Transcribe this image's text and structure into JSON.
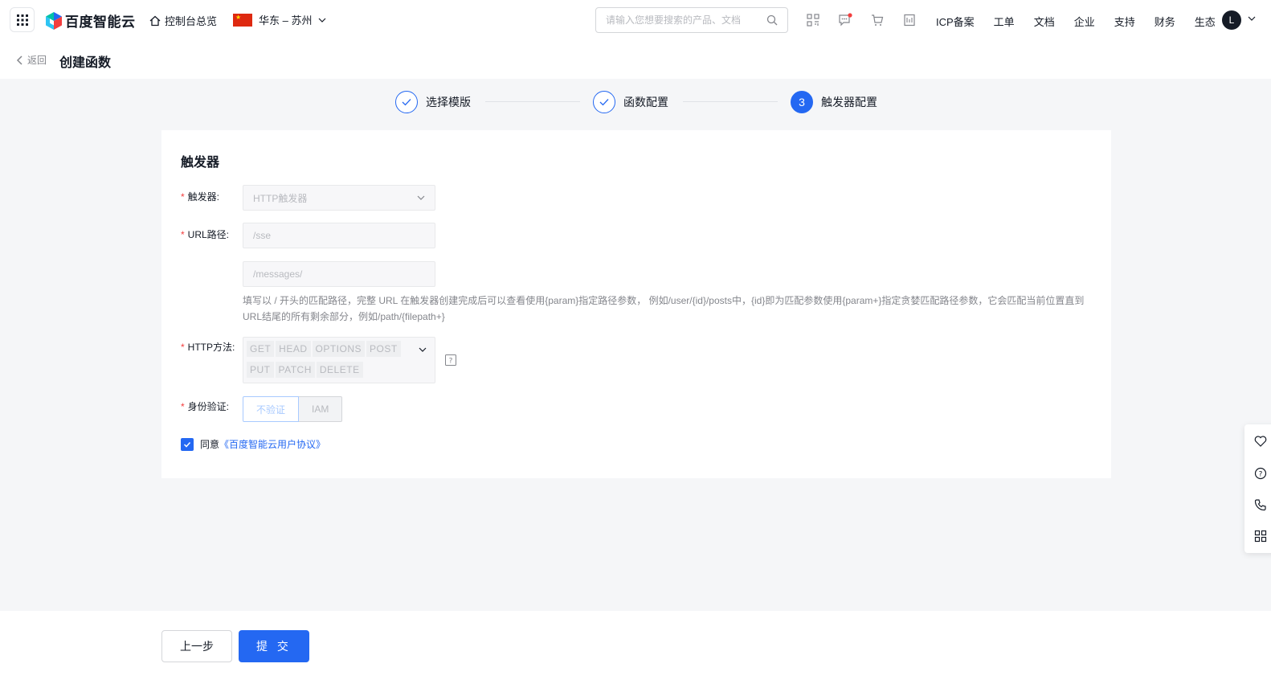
{
  "topbar": {
    "logo_text": "百度智能云",
    "overview_label": "控制台总览",
    "region_label": "华东 – 苏州",
    "search_placeholder": "请输入您想要搜索的产品、文档",
    "links": [
      "ICP备案",
      "工单",
      "文档",
      "企业",
      "支持",
      "财务",
      "生态"
    ],
    "avatar_letter": "L",
    "icons": [
      "qrcode-icon",
      "message-icon",
      "cart-icon",
      "invoice-icon"
    ],
    "message_badge_color": "#f33e3e"
  },
  "page_header": {
    "back_label": "返回",
    "title": "创建函数"
  },
  "steps": [
    {
      "label": "选择模版",
      "status": "done"
    },
    {
      "label": "函数配置",
      "status": "done"
    },
    {
      "label": "触发器配置",
      "status": "active",
      "number": "3"
    }
  ],
  "form": {
    "section_title": "触发器",
    "trigger": {
      "label": "触发器:",
      "value": "HTTP触发器"
    },
    "url": {
      "label": "URL路径:",
      "path1": "/sse",
      "path2": "/messages/"
    },
    "hint": "填写以 / 开头的匹配路径，完整 URL 在触发器创建完成后可以查看使用{param}指定路径参数， 例如/user/{id}/posts中，{id}即为匹配参数使用{param+}指定贪婪匹配路径参数，它会匹配当前位置直到URL结尾的所有剩余部分，例如/path/{filepath+}",
    "http_method": {
      "label": "HTTP方法:",
      "tags": [
        "GET",
        "HEAD",
        "OPTIONS",
        "POST",
        "PUT",
        "PATCH",
        "DELETE"
      ]
    },
    "auth": {
      "label": "身份验证:",
      "options": [
        "不验证",
        "IAM"
      ],
      "selected": "不验证"
    },
    "agree": {
      "checked": true,
      "prefix": "同意",
      "link": "《百度智能云用户协议》"
    }
  },
  "footer": {
    "prev_label": "上一步",
    "submit_label": "提 交"
  },
  "float_bar": [
    "heart-icon",
    "question-icon",
    "phone-icon",
    "apps-icon"
  ],
  "colors": {
    "accent": "#2468f2",
    "required": "#f33e3e",
    "bg": "#f5f6f8"
  }
}
